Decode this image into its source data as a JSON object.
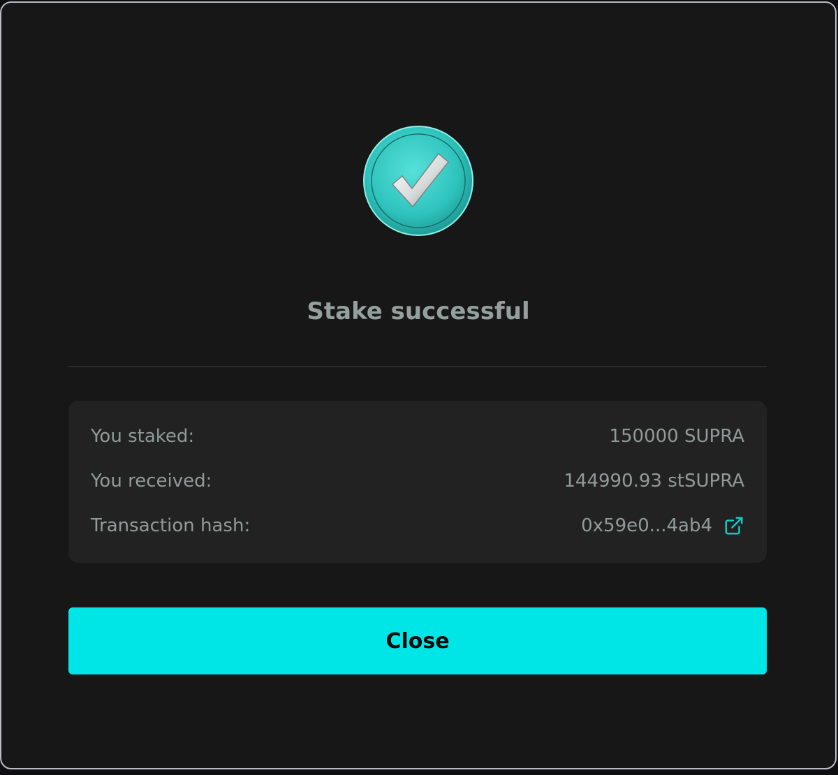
{
  "modal": {
    "title": "Stake successful",
    "icon": "check-circle-icon",
    "details": {
      "staked_label": "You staked:",
      "staked_value": "150000 SUPRA",
      "received_label": "You received:",
      "received_value": "144990.93 stSUPRA",
      "hash_label": "Transaction hash:",
      "hash_value": "0x59e0...4ab4",
      "hash_link_icon": "external-link-icon"
    },
    "close_label": "Close"
  },
  "colors": {
    "accent": "#00e6e6",
    "background": "#171717",
    "panel": "#222222",
    "text_muted": "#909b99",
    "title": "#93a09d"
  }
}
